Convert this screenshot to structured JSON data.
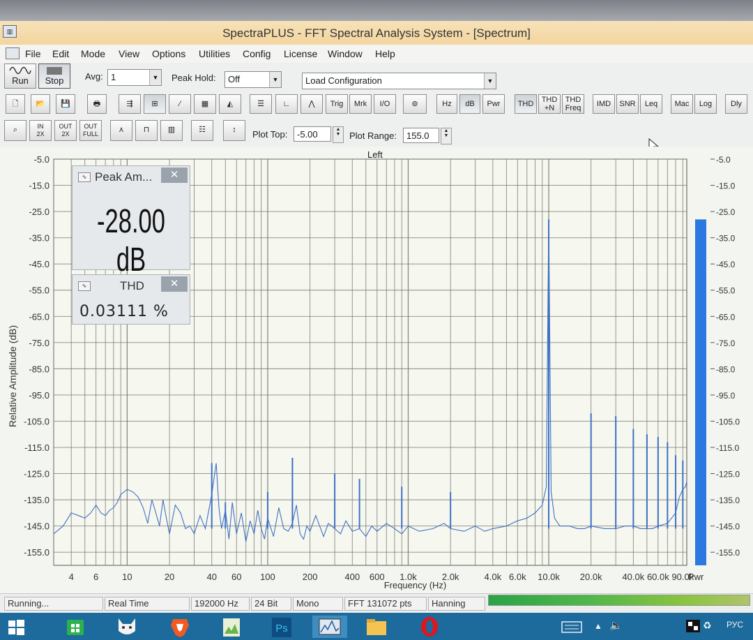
{
  "window": {
    "title": "SpectraPLUS - FFT Spectral Analysis System - [Spectrum]"
  },
  "menu": [
    "File",
    "Edit",
    "Mode",
    "View",
    "Options",
    "Utilities",
    "Config",
    "License",
    "Window",
    "Help"
  ],
  "toolbar": {
    "run_label": "Run",
    "stop_label": "Stop",
    "avg_label": "Avg:",
    "avg_value": "1",
    "peak_hold_label": "Peak Hold:",
    "peak_hold_value": "Off",
    "config_value": "Load Configuration",
    "plot_top_label": "Plot Top:",
    "plot_top_value": "-5.00",
    "plot_range_label": "Plot Range:",
    "plot_range_value": "155.0"
  },
  "toolbar_row2": {
    "trig": "Trig",
    "mrk": "Mrk",
    "io": "I/O",
    "hz": "Hz",
    "db": "dB",
    "pwr": "Pwr",
    "thd": "THD",
    "thdn_1": "THD",
    "thdn_2": "+N",
    "thdf_1": "THD",
    "thdf_2": "Freq",
    "imd": "IMD",
    "snr": "SNR",
    "leq": "Leq",
    "mac": "Mac",
    "log": "Log",
    "dly": "Dly"
  },
  "toolbar_row3": {
    "in2x_1": "IN",
    "in2x_2": "2X",
    "out2x_1": "OUT",
    "out2x_2": "2X",
    "outfull_1": "OUT",
    "outfull_2": "FULL"
  },
  "peak_panel": {
    "title": "Peak Am...",
    "value": "-28.00 dB"
  },
  "thd_panel": {
    "title": "THD",
    "value": "0.03111 %"
  },
  "status": {
    "running": "Running...",
    "mode": "Real Time",
    "sample_rate": "192000 Hz",
    "bits": "24 Bit",
    "channels": "Mono",
    "fft": "FFT 131072 pts",
    "window": "Hanning"
  },
  "taskbar": {
    "lang": "РУС"
  },
  "colors": {
    "trace": "#3f6fc4",
    "bar": "#2a78e0",
    "grid": "#6d6e6a",
    "panel_bg": "#e6e9ec",
    "plot_bg": "#f6f8ef"
  },
  "chart_data": {
    "type": "line",
    "title": "Left",
    "xlabel": "Frequency (Hz)",
    "ylabel": "Relative Amplitude (dB)",
    "x_scale": "log",
    "xlim": [
      3,
      96000
    ],
    "ylim": [
      -160,
      -5
    ],
    "x_ticks": [
      4,
      6,
      10,
      20,
      40,
      60,
      100,
      200,
      400,
      600,
      1000,
      2000,
      4000,
      6000,
      10000,
      20000,
      40000,
      60000,
      90000
    ],
    "x_tick_labels": [
      "4",
      "6",
      "10",
      "20",
      "40",
      "60",
      "100",
      "200",
      "400",
      "600",
      "1.0k",
      "2.0k",
      "4.0k",
      "6.0k",
      "10.0k",
      "20.0k",
      "40.0k",
      "60.0k",
      "90.0k"
    ],
    "x_tick_label_suffix": "Pwr",
    "y_ticks": [
      -5,
      -15,
      -25,
      -35,
      -45,
      -55,
      -65,
      -75,
      -85,
      -95,
      -105,
      -115,
      -125,
      -135,
      -145,
      -155
    ],
    "y_tick_labels": [
      "-5.0",
      "-15.0",
      "-25.0",
      "-35.0",
      "-45.0",
      "-55.0",
      "-65.0",
      "-75.0",
      "-85.0",
      "-95.0",
      "-105.0",
      "-115.0",
      "-125.0",
      "-135.0",
      "-145.0",
      "-155.0"
    ],
    "grid": true,
    "series": [
      {
        "x": [
          3,
          3.5,
          4,
          4.5,
          5,
          5.5,
          6,
          6.5,
          7,
          7.5,
          8,
          8.5,
          9,
          10,
          11,
          12,
          13,
          14,
          15,
          16,
          17,
          18,
          19,
          20,
          22,
          24,
          26,
          28,
          30,
          33,
          36,
          40,
          43,
          45,
          47,
          50,
          53,
          56,
          60,
          65,
          70,
          75,
          80,
          85,
          90,
          95,
          100,
          110,
          120,
          130,
          140,
          150,
          160,
          170,
          180,
          190,
          200,
          220,
          250,
          270,
          300,
          330,
          360,
          400,
          450,
          500,
          550,
          600,
          700,
          800,
          900,
          1000,
          1200,
          1500,
          1800,
          2000,
          2500,
          3000,
          3500,
          4000,
          5000,
          6000,
          7000,
          8000,
          9000,
          9600,
          10000,
          10400,
          11000,
          12000,
          14000,
          16000,
          18000,
          20000,
          25000,
          30000,
          35000,
          40000,
          45000,
          50000,
          55000,
          60000,
          70000,
          80000,
          85000,
          90000,
          94000,
          96000
        ],
        "y": [
          -148,
          -145,
          -140,
          -141,
          -142,
          -140,
          -137,
          -140,
          -141,
          -139,
          -138,
          -136,
          -133,
          -131,
          -132,
          -134,
          -138,
          -144,
          -135,
          -140,
          -145,
          -135,
          -142,
          -148,
          -137,
          -140,
          -146,
          -145,
          -148,
          -141,
          -146,
          -133,
          -121,
          -138,
          -146,
          -139,
          -150,
          -136,
          -148,
          -140,
          -151,
          -143,
          -148,
          -139,
          -146,
          -150,
          -142,
          -149,
          -138,
          -146,
          -147,
          -144,
          -137,
          -148,
          -150,
          -145,
          -147,
          -141,
          -149,
          -144,
          -146,
          -148,
          -143,
          -147,
          -146,
          -149,
          -145,
          -147,
          -144,
          -146,
          -148,
          -145,
          -147,
          -146,
          -144,
          -146,
          -147,
          -145,
          -147,
          -146,
          -145,
          -143,
          -142,
          -140,
          -137,
          -130,
          -28,
          -132,
          -142,
          -145,
          -145,
          -146,
          -146,
          -145,
          -146,
          -146,
          -145,
          -145,
          -146,
          -146,
          -146,
          -145,
          -144,
          -140,
          -134,
          -131,
          -130,
          -128
        ]
      }
    ],
    "peaks": [
      {
        "x": 40,
        "y": -121
      },
      {
        "x": 50,
        "y": -136
      },
      {
        "x": 100,
        "y": -132
      },
      {
        "x": 150,
        "y": -119
      },
      {
        "x": 300,
        "y": -125
      },
      {
        "x": 450,
        "y": -127
      },
      {
        "x": 900,
        "y": -130
      },
      {
        "x": 2000,
        "y": -132
      },
      {
        "x": 10000,
        "y": -28
      },
      {
        "x": 20000,
        "y": -102
      },
      {
        "x": 30000,
        "y": -103
      },
      {
        "x": 40000,
        "y": -108
      },
      {
        "x": 50000,
        "y": -110
      },
      {
        "x": 60000,
        "y": -111
      },
      {
        "x": 70000,
        "y": -113
      },
      {
        "x": 80000,
        "y": -118
      },
      {
        "x": 90000,
        "y": -120
      }
    ],
    "level_bar": {
      "value": -28,
      "range": [
        -160,
        -5
      ]
    }
  }
}
